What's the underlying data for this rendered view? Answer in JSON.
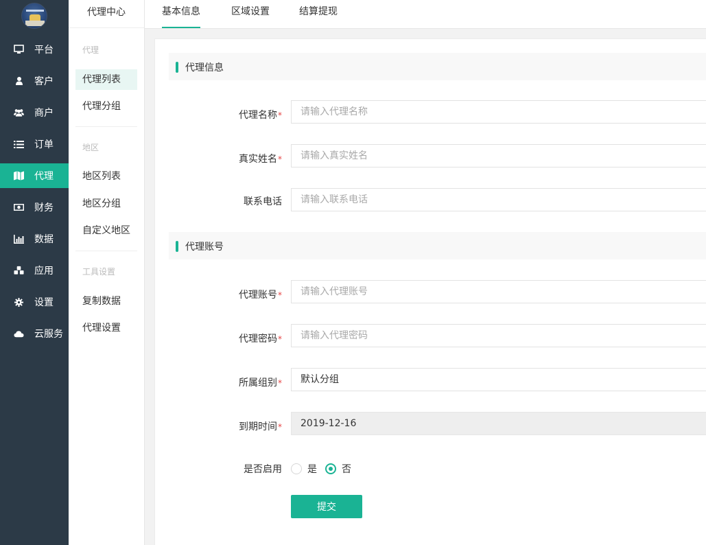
{
  "nav": {
    "items": [
      {
        "label": "平台",
        "icon": "monitor-icon"
      },
      {
        "label": "客户",
        "icon": "user-icon"
      },
      {
        "label": "商户",
        "icon": "users-icon"
      },
      {
        "label": "订单",
        "icon": "list-icon"
      },
      {
        "label": "代理",
        "icon": "map-icon",
        "active": true
      },
      {
        "label": "财务",
        "icon": "money-icon"
      },
      {
        "label": "数据",
        "icon": "bar-chart-icon"
      },
      {
        "label": "应用",
        "icon": "cubes-icon"
      },
      {
        "label": "设置",
        "icon": "gear-icon"
      },
      {
        "label": "云服务",
        "icon": "cloud-icon"
      }
    ]
  },
  "submenu": {
    "title": "代理中心",
    "groups": [
      {
        "title": "代理",
        "items": [
          "代理列表",
          "代理分组"
        ]
      },
      {
        "title": "地区",
        "items": [
          "地区列表",
          "地区分组",
          "自定义地区"
        ]
      },
      {
        "title": "工具设置",
        "items": [
          "复制数据",
          "代理设置"
        ]
      }
    ],
    "active_item": "代理列表"
  },
  "tabs": [
    {
      "label": "基本信息",
      "active": true
    },
    {
      "label": "区域设置"
    },
    {
      "label": "结算提现"
    }
  ],
  "form": {
    "section1": "代理信息",
    "section2": "代理账号",
    "fields": {
      "agent_name": {
        "label": "代理名称",
        "placeholder": "请输入代理名称",
        "required": true
      },
      "real_name": {
        "label": "真实姓名",
        "placeholder": "请输入真实姓名",
        "required": true
      },
      "phone": {
        "label": "联系电话",
        "placeholder": "请输入联系电话",
        "required": false
      },
      "account": {
        "label": "代理账号",
        "placeholder": "请输入代理账号",
        "required": true
      },
      "password": {
        "label": "代理密码",
        "placeholder": "请输入代理密码",
        "required": true
      },
      "group": {
        "label": "所属组别",
        "value": "默认分组",
        "required": true
      },
      "expire": {
        "label": "到期时间",
        "value": "2019-12-16",
        "required": true
      },
      "enabled": {
        "label": "是否启用",
        "options": [
          "是",
          "否"
        ],
        "selected": "否"
      }
    },
    "required_mark": "*",
    "submit_label": "提交"
  },
  "colors": {
    "accent": "#1ab394",
    "nav_bg": "#2c3a47",
    "required": "#e64545"
  }
}
